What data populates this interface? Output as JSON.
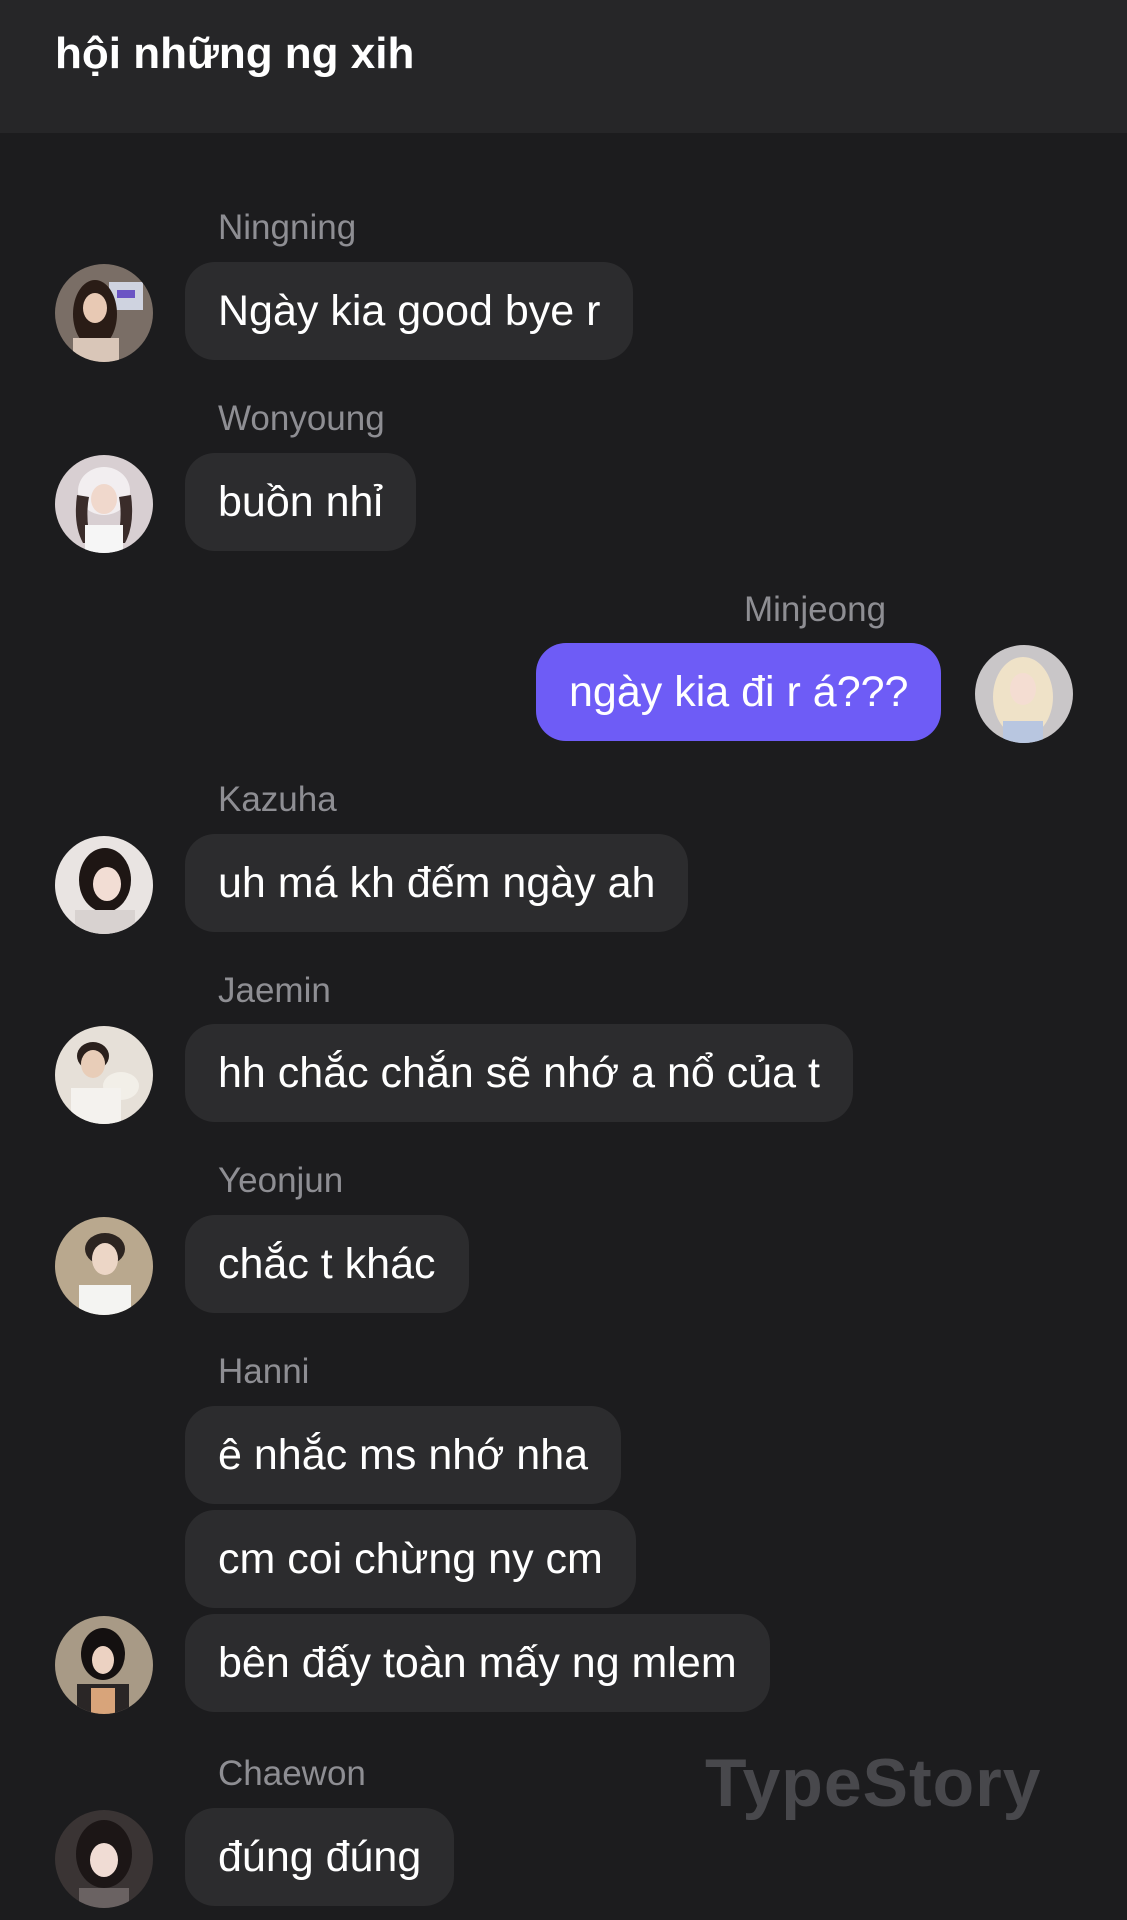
{
  "header": {
    "title": "hội những ng xih"
  },
  "messages": [
    {
      "sender": "Ningning",
      "avatar": "avatar-ningning",
      "texts": [
        "Ngày kia good bye r"
      ]
    },
    {
      "sender": "Wonyoung",
      "avatar": "avatar-wonyoung",
      "texts": [
        "buồn nhỉ"
      ]
    },
    {
      "sender": "Minjeong",
      "avatar": "avatar-minjeong",
      "self": true,
      "texts": [
        "ngày kia đi r á???"
      ]
    },
    {
      "sender": "Kazuha",
      "avatar": "avatar-kazuha",
      "texts": [
        "uh má kh đếm ngày ah"
      ]
    },
    {
      "sender": "Jaemin",
      "avatar": "avatar-jaemin",
      "texts": [
        "hh chắc chắn sẽ nhớ a nổ của t"
      ]
    },
    {
      "sender": "Yeonjun",
      "avatar": "avatar-yeonjun",
      "texts": [
        "chắc t khác"
      ]
    },
    {
      "sender": "Hanni",
      "avatar": "avatar-hanni",
      "texts": [
        "ê nhắc ms nhớ nha",
        "cm coi chừng ny cm",
        "bên đấy toàn mấy ng mlem"
      ]
    },
    {
      "sender": "Chaewon",
      "avatar": "avatar-chaewon",
      "texts": [
        "đúng đúng"
      ]
    }
  ],
  "watermark": "TypeStory",
  "colors": {
    "background": "#1c1c1e",
    "header": "#262628",
    "bubble_other": "#2c2c2e",
    "bubble_self": "#6e5cf6",
    "sender_name": "#8e8e93"
  }
}
